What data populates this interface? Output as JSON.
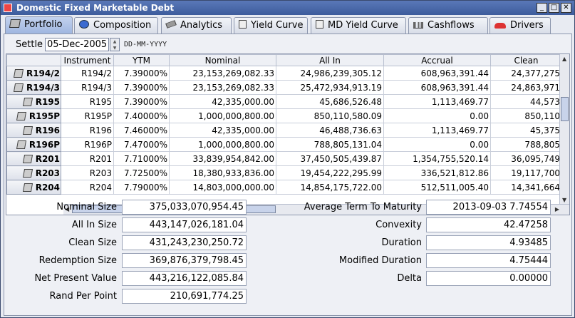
{
  "window": {
    "title": "Domestic Fixed Marketable Debt"
  },
  "tabs": [
    {
      "label": "Portfolio",
      "icon": "portfolio-icon"
    },
    {
      "label": "Composition",
      "icon": "pie-icon"
    },
    {
      "label": "Analytics",
      "icon": "analytics-icon"
    },
    {
      "label": "Yield Curve",
      "icon": "curve-icon"
    },
    {
      "label": "MD Yield Curve",
      "icon": "md-curve-icon"
    },
    {
      "label": "Cashflows",
      "icon": "bar-chart-icon"
    },
    {
      "label": "Drivers",
      "icon": "car-icon"
    }
  ],
  "settle": {
    "label": "Settle",
    "value": "05-Dec-2005",
    "format": "DD-MM-YYYY"
  },
  "table": {
    "columns": [
      "Instrument",
      "YTM",
      "Nominal",
      "All In",
      "Accrual",
      "Clean"
    ],
    "rows": [
      {
        "head": "R194/2",
        "cells": [
          "R194/2",
          "7.39000%",
          "23,153,269,082.33",
          "24,986,239,305.12",
          "608,963,391.44",
          "24,377,275"
        ]
      },
      {
        "head": "R194/3",
        "cells": [
          "R194/3",
          "7.39000%",
          "23,153,269,082.33",
          "25,472,934,913.19",
          "608,963,391.44",
          "24,863,971"
        ]
      },
      {
        "head": "R195",
        "cells": [
          "R195",
          "7.39000%",
          "42,335,000.00",
          "45,686,526.48",
          "1,113,469.77",
          "44,573"
        ]
      },
      {
        "head": "R195P",
        "cells": [
          "R195P",
          "7.40000%",
          "1,000,000,800.00",
          "850,110,580.09",
          "0.00",
          "850,110"
        ]
      },
      {
        "head": "R196",
        "cells": [
          "R196",
          "7.46000%",
          "42,335,000.00",
          "46,488,736.63",
          "1,113,469.77",
          "45,375"
        ]
      },
      {
        "head": "R196P",
        "cells": [
          "R196P",
          "7.47000%",
          "1,000,000,800.00",
          "788,805,131.04",
          "0.00",
          "788,805"
        ]
      },
      {
        "head": "R201",
        "cells": [
          "R201",
          "7.71000%",
          "33,839,954,842.00",
          "37,450,505,439.87",
          "1,354,755,520.14",
          "36,095,749"
        ]
      },
      {
        "head": "R203",
        "cells": [
          "R203",
          "7.72500%",
          "18,380,933,836.00",
          "19,454,222,295.99",
          "336,521,812.86",
          "19,117,700"
        ]
      },
      {
        "head": "R204",
        "cells": [
          "R204",
          "7.79000%",
          "14,803,000,000.00",
          "14,854,175,722.00",
          "512,511,005.40",
          "14,341,664"
        ]
      }
    ]
  },
  "summary_left": [
    {
      "label": "Nominal Size",
      "value": "375,033,070,954.45"
    },
    {
      "label": "All In Size",
      "value": "443,147,026,181.04"
    },
    {
      "label": "Clean Size",
      "value": "431,243,230,250.72"
    },
    {
      "label": "Redemption Size",
      "value": "369,876,379,798.45"
    },
    {
      "label": "Net Present Value",
      "value": "443,216,122,085.84"
    },
    {
      "label": "Rand Per Point",
      "value": "210,691,774.25"
    }
  ],
  "summary_right": [
    {
      "label": "Average Term To Maturity",
      "value": "2013-09-03 7.74554"
    },
    {
      "label": "Convexity",
      "value": "42.47258"
    },
    {
      "label": "Duration",
      "value": "4.93485"
    },
    {
      "label": "Modified Duration",
      "value": "4.75444"
    },
    {
      "label": "Delta",
      "value": "0.00000"
    }
  ]
}
